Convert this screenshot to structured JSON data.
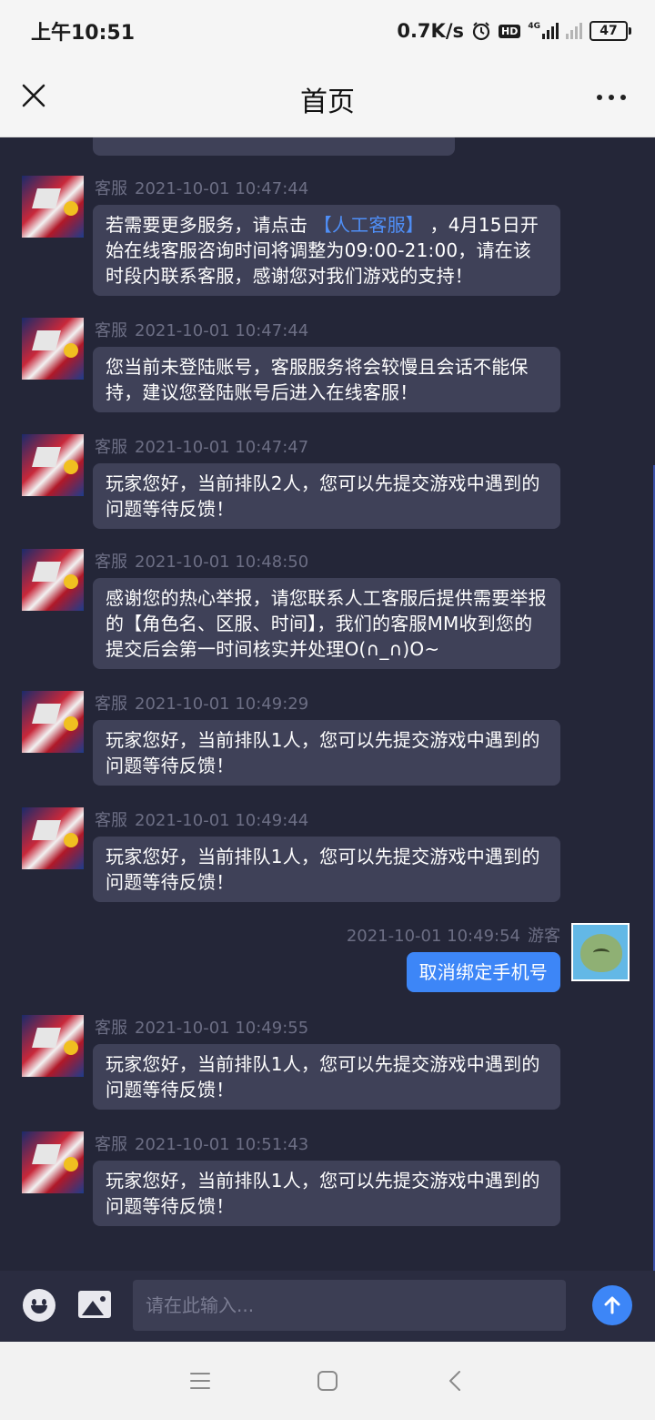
{
  "status_bar": {
    "time": "上午10:51",
    "speed": "0.7K/s",
    "hd_label": "HD",
    "network_type": "4G",
    "battery": "47"
  },
  "header": {
    "title": "首页"
  },
  "messages": [
    {
      "sender": "客服",
      "time": "2021-10-01 10:47:44",
      "text_before": "若需要更多服务，请点击 ",
      "link": "【人工客服】",
      "text_after": " ，4月15日开始在线客服咨询时间将调整为09:00-21:00，请在该时段内联系客服，感谢您对我们游戏的支持！"
    },
    {
      "sender": "客服",
      "time": "2021-10-01 10:47:44",
      "text": "您当前未登陆账号，客服服务将会较慢且会话不能保持，建议您登陆账号后进入在线客服！"
    },
    {
      "sender": "客服",
      "time": "2021-10-01 10:47:47",
      "text": "玩家您好，当前排队2人，您可以先提交游戏中遇到的问题等待反馈！"
    },
    {
      "sender": "客服",
      "time": "2021-10-01 10:48:50",
      "text": "感谢您的热心举报，请您联系人工客服后提供需要举报的【角色名、区服、时间】，我们的客服MM收到您的提交后会第一时间核实并处理O(∩_∩)O~"
    },
    {
      "sender": "客服",
      "time": "2021-10-01 10:49:29",
      "text": "玩家您好，当前排队1人，您可以先提交游戏中遇到的问题等待反馈！"
    },
    {
      "sender": "客服",
      "time": "2021-10-01 10:49:44",
      "text": "玩家您好，当前排队1人，您可以先提交游戏中遇到的问题等待反馈！"
    },
    {
      "sender": "游客",
      "time": "2021-10-01 10:49:54",
      "text": "取消绑定手机号"
    },
    {
      "sender": "客服",
      "time": "2021-10-01 10:49:55",
      "text": "玩家您好，当前排队1人，您可以先提交游戏中遇到的问题等待反馈！"
    },
    {
      "sender": "客服",
      "time": "2021-10-01 10:51:43",
      "text": "玩家您好，当前排队1人，您可以先提交游戏中遇到的问题等待反馈！"
    }
  ],
  "input": {
    "placeholder": "请在此输入..."
  },
  "colors": {
    "chat_bg": "#242638",
    "bubble_bg": "#3f4158",
    "user_bubble": "#3d86f7",
    "link": "#4f8ff7"
  },
  "icons": [
    "close-icon",
    "more-icon",
    "emoji-icon",
    "image-icon",
    "send-arrow-icon",
    "menu-icon",
    "home-icon",
    "back-icon",
    "alarm-icon",
    "signal-icon",
    "battery-icon"
  ]
}
